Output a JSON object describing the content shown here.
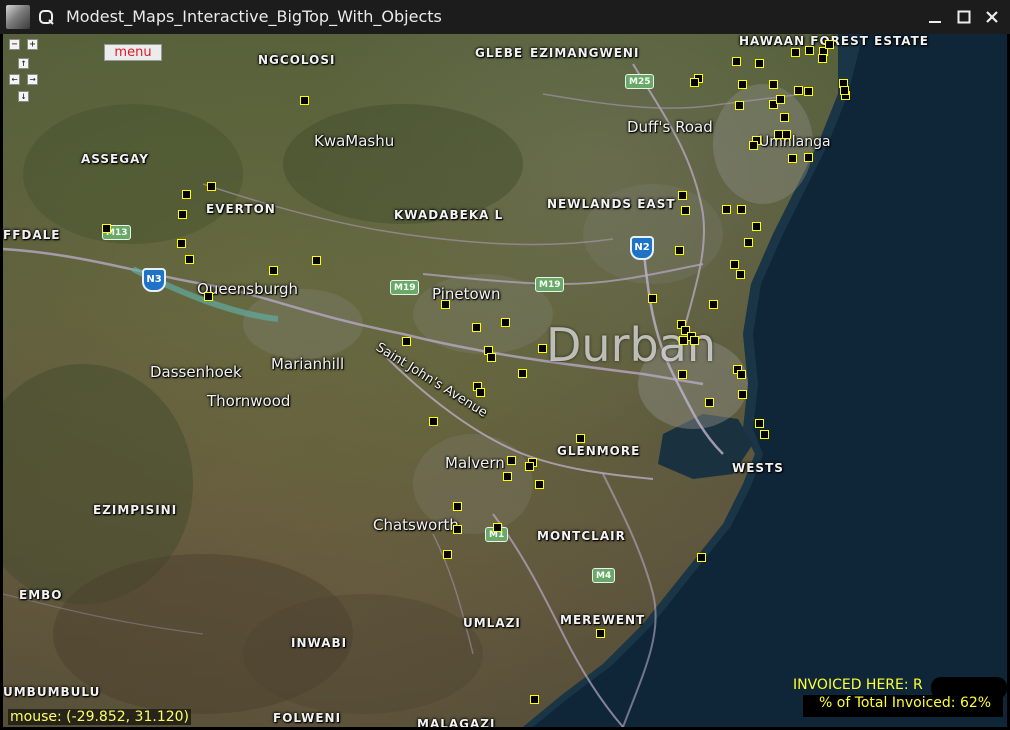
{
  "window": {
    "title": "Modest_Maps_Interactive_BigTop_With_Objects",
    "minimize_icon": "minimize-icon",
    "maximize_icon": "maximize-icon",
    "close_icon": "close-icon"
  },
  "map_controls": {
    "zoom_out": "−",
    "zoom_in": "+",
    "pan_up": "↑",
    "pan_left": "←",
    "pan_right": "→",
    "pan_down": "↓",
    "menu_label": "menu"
  },
  "places": {
    "districts": [
      "NGCOLOSI",
      "GLEBE",
      "EZIMANGWENI",
      "HAWAAN FOREST ESTATE",
      "ASSEGAY",
      "EVERTON",
      "KWADABEKA L",
      "NEWLANDS EAST",
      "FFDALE",
      "GLENMORE",
      "WESTS",
      "EZIMPISINI",
      "MONTCLAIR",
      "EMBO",
      "UMLAZI",
      "MEREWENT",
      "INWABI",
      "UMBUMBULU",
      "FOLWENI",
      "MALAGAZI"
    ],
    "suburbs": [
      "KwaMashu",
      "Duff's Road",
      "Queensburgh",
      "Pinetown",
      "Marianhill",
      "Dassenhoek",
      "Thornwood",
      "Malvern",
      "Chatsworth",
      "Umhlanga"
    ],
    "city": "Durban",
    "road_name": "Saint John's Avenue"
  },
  "route_shields": [
    "M25",
    "M13",
    "M19",
    "M19",
    "M1",
    "M4"
  ],
  "national_shields": [
    "N2",
    "N3"
  ],
  "markers_count_label": "",
  "status": {
    "mouse_label": "mouse:",
    "mouse_coords": "(-29.852, 31.120)",
    "invoiced_here": "INVOICED HERE: R",
    "pct_total": "% of Total Invoiced: 62%"
  },
  "colors": {
    "marker_border": "#ffff00",
    "marker_fill": "#000000",
    "status_text": "#ffff33",
    "menu_text": "#e0162b",
    "ocean": "#0f2638"
  }
}
